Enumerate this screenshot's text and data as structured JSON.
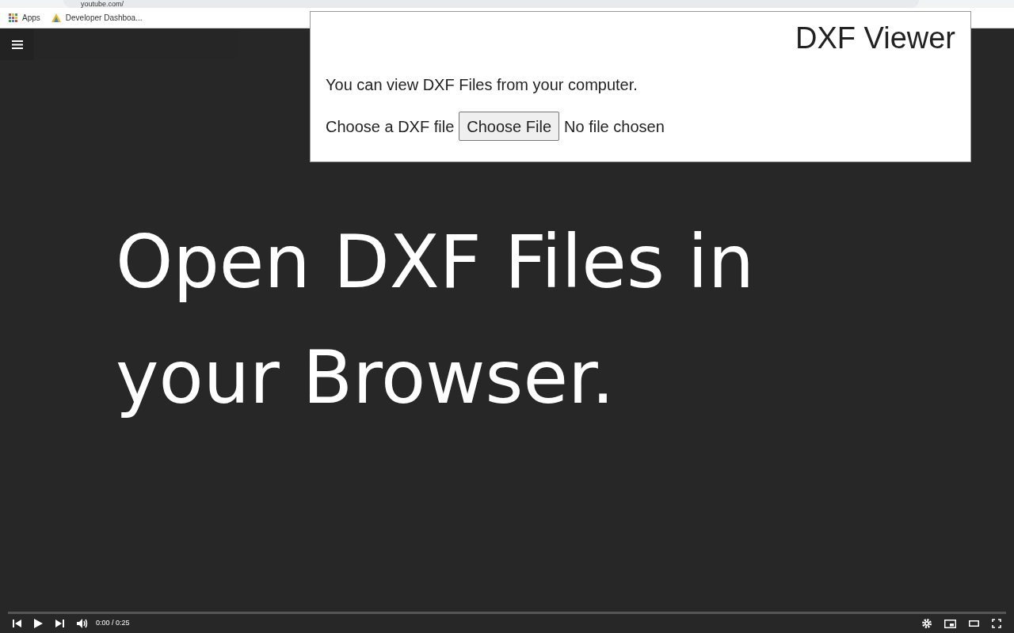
{
  "browser": {
    "url": "youtube.com/",
    "bookmarks": [
      {
        "label": "Apps",
        "kind": "apps"
      },
      {
        "label": "Developer Dashboa...",
        "kind": "site"
      }
    ]
  },
  "popup": {
    "title": "DXF Viewer",
    "description": "You can view DXF Files from your computer.",
    "file_label": "Choose a DXF file",
    "button": "Choose File",
    "file_status": "No file chosen"
  },
  "video": {
    "title_lines": [
      "Open DXF Files in",
      "your Browser."
    ],
    "time": "0:00 / 0:25"
  }
}
